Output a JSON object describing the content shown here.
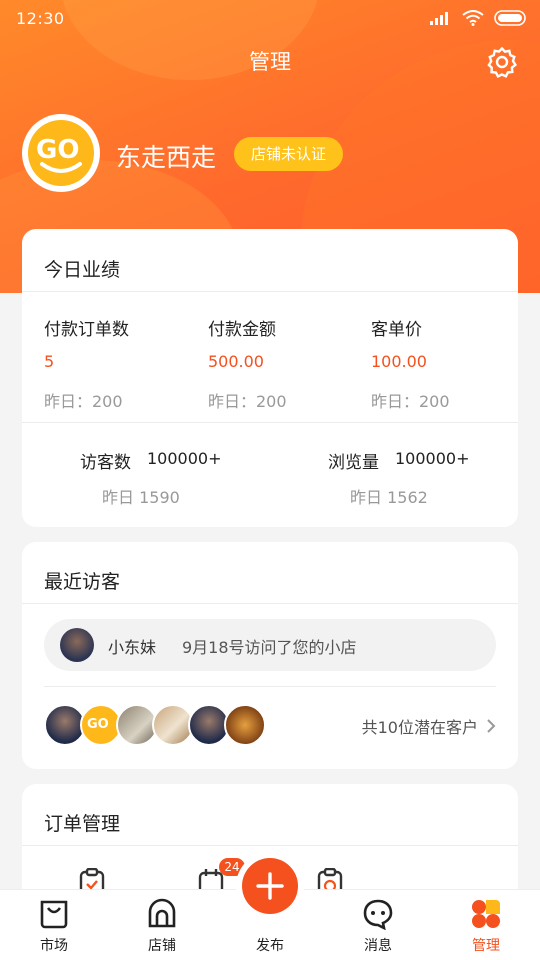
{
  "status_bar": {
    "time": "12:30"
  },
  "header": {
    "title": "管理"
  },
  "store": {
    "name": "东走西走",
    "verify_label": "店铺未认证",
    "logo_text": "GO"
  },
  "today": {
    "title": "今日业绩",
    "metrics": [
      {
        "label": "付款订单数",
        "value": "5",
        "yesterday": "昨日：200"
      },
      {
        "label": "付款金额",
        "value": "500.00",
        "yesterday": "昨日：200"
      },
      {
        "label": "客单价",
        "value": "100.00",
        "yesterday": "昨日：200"
      }
    ],
    "traffic": [
      {
        "label": "访客数",
        "value": "100000+",
        "yesterday": "昨日  1590"
      },
      {
        "label": "浏览量",
        "value": "100000+",
        "yesterday": "昨日  1562"
      }
    ]
  },
  "recent_visitors": {
    "title": "最近访客",
    "latest": {
      "name": "小东妹",
      "message": "9月18号访问了您的小店"
    },
    "potential_label": "共10位潜在客户"
  },
  "orders": {
    "title": "订单管理",
    "badge_count": "24"
  },
  "tabbar": {
    "items": [
      {
        "label": "市场",
        "icon": "bag-icon"
      },
      {
        "label": "店铺",
        "icon": "store-icon"
      },
      {
        "label": "发布",
        "icon": "plus-icon"
      },
      {
        "label": "消息",
        "icon": "chat-icon"
      },
      {
        "label": "管理",
        "icon": "grid-icon"
      }
    ]
  },
  "colors": {
    "accent": "#f4511e",
    "hero": "#ff6a2c",
    "badge": "#ffc21a"
  }
}
